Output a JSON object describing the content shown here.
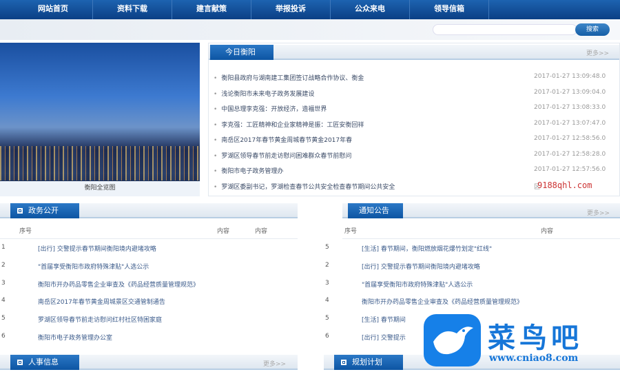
{
  "nav": [
    "网站首页",
    "资料下载",
    "建言献策",
    "举报投诉",
    "公众来电",
    "领导信箱"
  ],
  "search": {
    "button": "搜索",
    "placeholder": ""
  },
  "photo": {
    "caption": "衡阳全览图"
  },
  "today": {
    "title": "今日衡阳",
    "more": "更多>>",
    "items": [
      {
        "t": "衡阳县政府与湖南建工集团签订战略合作协议、衡金",
        "d": "2017-01-27 13:09:48.0"
      },
      {
        "t": "浅论衡阳市未来电子政务发展建设",
        "d": "2017-01-27 13:09:04.0"
      },
      {
        "t": "中国总理李克强：开放经济，造福世界",
        "d": "2017-01-27 13:08:33.0"
      },
      {
        "t": "李克强：工匠精神和企业家精神是振：工匠安衡回祥",
        "d": "2017-01-27 13:07:47.0"
      },
      {
        "t": "南岳区2017年春节黄金周城春节黄金2017年春",
        "d": "2017-01-27 12:58:56.0"
      },
      {
        "t": "罗湖区领导春节前走访慰问困难群众春节前慰问",
        "d": "2017-01-27 12:58:28.0"
      },
      {
        "t": "衡阳市电子政务管理办",
        "d": "2017-01-27 12:57:56.0"
      },
      {
        "t": "罗湖区委副书记，罗湖检查春节公共安全检查春节期间公共安全",
        "d": "区"
      }
    ]
  },
  "gov": {
    "title": "政务公开",
    "col_no": "序号",
    "col_c1": "内容",
    "col_c2": "内容",
    "rows": [
      {
        "n": "1",
        "t": "[出行] 交警提示春节期间衡阳境内避堵攻略"
      },
      {
        "n": "2",
        "t": "\"首届享受衡阳市政府特殊津贴\"人选公示"
      },
      {
        "n": "3",
        "t": "衡阳市开办药品零售企业审查及《药品经营质量管理规范》"
      },
      {
        "n": "4",
        "t": "南岳区2017年春节黄金周城景区交通管制通告"
      },
      {
        "n": "5",
        "t": "罗湖区领导春节前走访慰问红村社区特困家庭"
      },
      {
        "n": "6",
        "t": "衡阳市电子政务管理办公室"
      }
    ]
  },
  "notice": {
    "title": "通知公告",
    "more": "更多>>",
    "col_no": "序号",
    "col_c": "内容",
    "rows": [
      {
        "n": "5",
        "t": "[生活] 春节期间，衡阳燃放烟花爆竹划定\"红线\""
      },
      {
        "n": "2",
        "t": "[出行] 交警提示春节期间衡阳境内避堵攻略"
      },
      {
        "n": "3",
        "t": "\"首届享受衡阳市政府特殊津贴\"人选公示"
      },
      {
        "n": "4",
        "t": "衡阳市开办药品零售企业审查及《药品经营质量管理规范》"
      },
      {
        "n": "5",
        "t": "[生活] 春节期间"
      },
      {
        "n": "6",
        "t": "[出行] 交警提示"
      }
    ]
  },
  "hr": {
    "title": "人事信息",
    "more": "更多>>"
  },
  "plan": {
    "title": "规划计划"
  },
  "watermark": {
    "site": "9188qhl.com",
    "brand": "菜鸟吧",
    "url": "www.cniao8.com"
  }
}
